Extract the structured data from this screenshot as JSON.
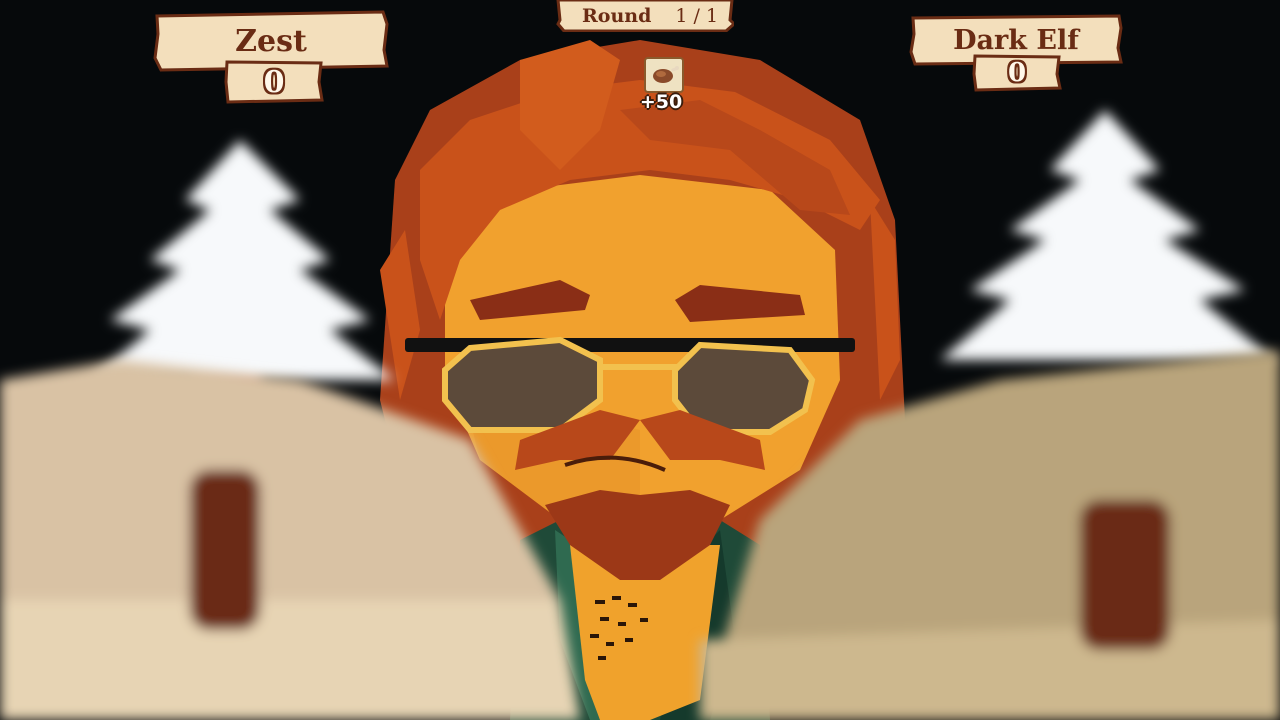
{
  "hud": {
    "round": {
      "label": "Round",
      "value": "1 / 1"
    },
    "players": [
      {
        "name": "Zest",
        "score": "0"
      },
      {
        "name": "Dark Elf",
        "score": "0"
      }
    ],
    "bonus": {
      "icon": "roast-meat-icon",
      "text": "+50"
    }
  },
  "colors": {
    "background": "#06090b",
    "plank": "#f3dfbc",
    "plank_text": "#6a2c14",
    "hair": "#c9521a",
    "skin": "#f2a230",
    "snow": "#f7f9fb"
  }
}
